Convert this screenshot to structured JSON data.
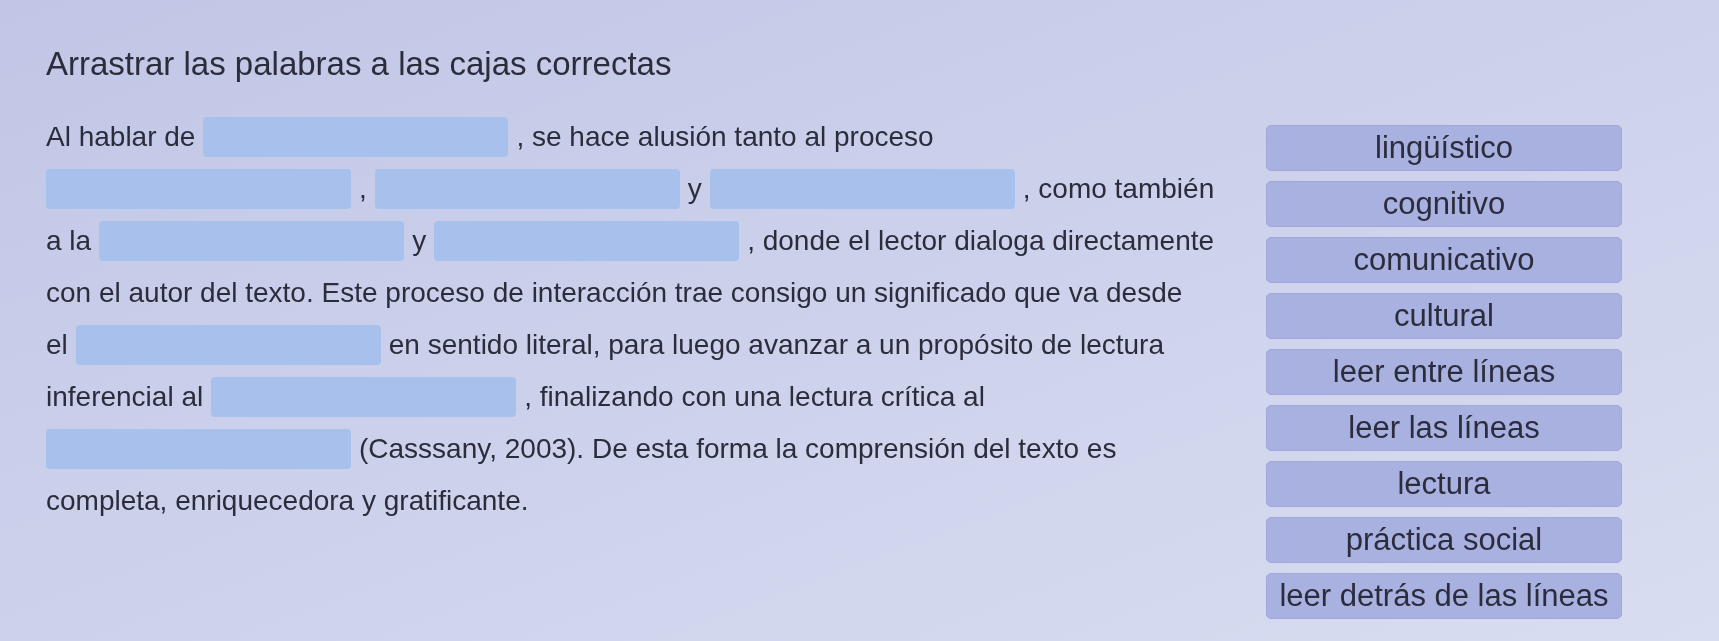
{
  "title": "Arrastrar las palabras a las cajas correctas",
  "passage": [
    [
      {
        "kind": "text",
        "text": "Al hablar de"
      },
      {
        "kind": "blank"
      },
      {
        "kind": "text",
        "text": ", se hace alusión tanto al proceso"
      }
    ],
    [
      {
        "kind": "blank"
      },
      {
        "kind": "text",
        "text": ","
      },
      {
        "kind": "blank"
      },
      {
        "kind": "text",
        "text": "y"
      },
      {
        "kind": "blank"
      },
      {
        "kind": "text",
        "text": ", como también"
      }
    ],
    [
      {
        "kind": "text",
        "text": "a la"
      },
      {
        "kind": "blank"
      },
      {
        "kind": "text",
        "text": "y"
      },
      {
        "kind": "blank"
      },
      {
        "kind": "text",
        "text": ", donde el lector dialoga directamente"
      }
    ],
    [
      {
        "kind": "text",
        "text": "con el autor del texto. Este proceso de interacción trae consigo un significado que va desde"
      }
    ],
    [
      {
        "kind": "text",
        "text": "el"
      },
      {
        "kind": "blank"
      },
      {
        "kind": "text",
        "text": "en sentido literal, para luego avanzar a un propósito de lectura"
      }
    ],
    [
      {
        "kind": "text",
        "text": "inferencial al"
      },
      {
        "kind": "blank"
      },
      {
        "kind": "text",
        "text": ", finalizando con una lectura crítica al"
      }
    ],
    [
      {
        "kind": "blank"
      },
      {
        "kind": "text",
        "text": "(Casssany, 2003). De esta forma la comprensión del texto es"
      }
    ],
    [
      {
        "kind": "text",
        "text": "completa, enriquecedora y gratificante."
      }
    ]
  ],
  "word_bank": [
    {
      "text": "lingüístico"
    },
    {
      "text": "cognitivo"
    },
    {
      "text": "comunicativo"
    },
    {
      "text": "cultural"
    },
    {
      "text": "leer entre líneas"
    },
    {
      "text": "leer las líneas"
    },
    {
      "text": "lectura"
    },
    {
      "text": "práctica social"
    },
    {
      "text": "leer detrás de las líneas"
    }
  ]
}
